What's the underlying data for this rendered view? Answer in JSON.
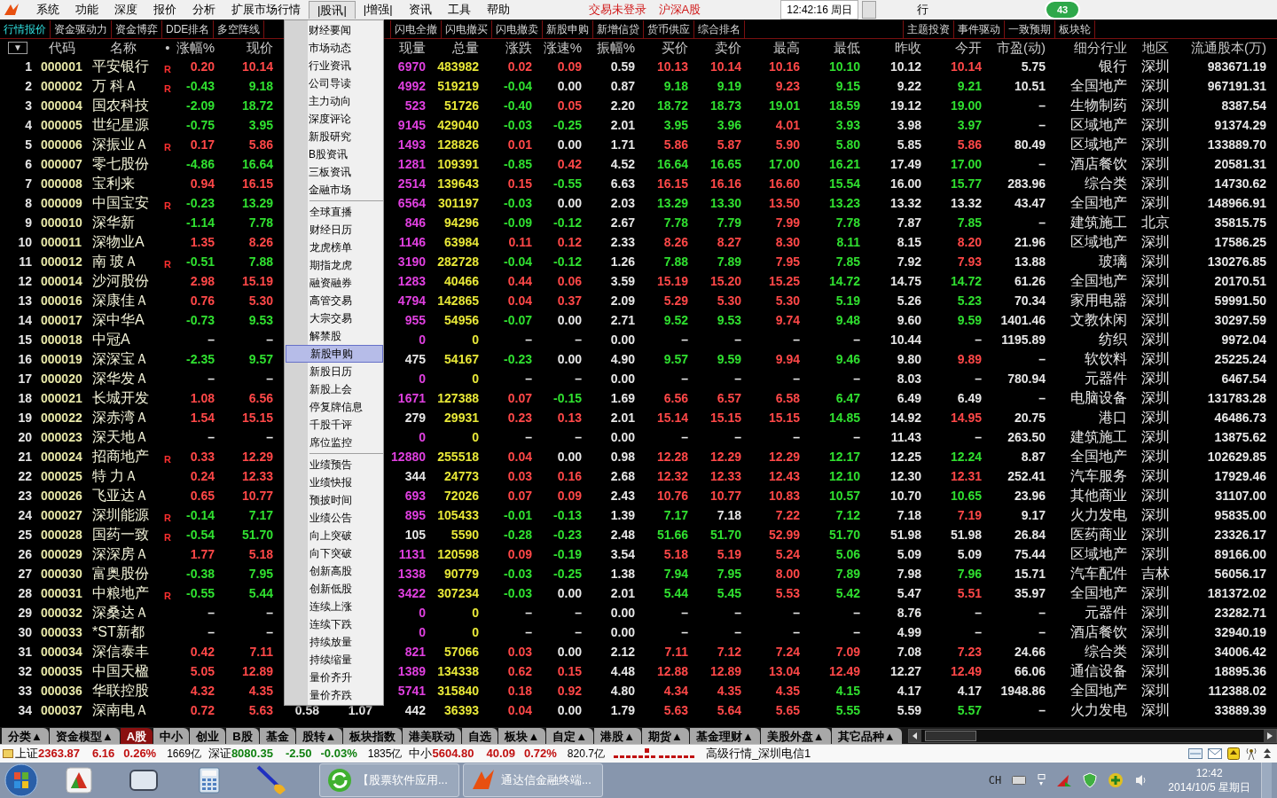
{
  "menubar": {
    "items": [
      {
        "label": "系统",
        "selected": false
      },
      {
        "label": "功能",
        "selected": false
      },
      {
        "label": "深度",
        "selected": false
      },
      {
        "label": "报价",
        "selected": false
      },
      {
        "label": "分析",
        "selected": false
      },
      {
        "label": "扩展市场行情",
        "selected": false
      },
      {
        "label": "|股讯|",
        "selected": true
      },
      {
        "label": "|增强|",
        "selected": false
      },
      {
        "label": "资讯",
        "selected": false
      },
      {
        "label": "工具",
        "selected": false
      },
      {
        "label": "帮助",
        "selected": false
      }
    ],
    "notices": [
      "交易未登录",
      "沪深A股"
    ],
    "clock": "12:42:16 周日",
    "badge": "43",
    "cut_label": "行"
  },
  "tabs": {
    "left": [
      {
        "label": "行情报价",
        "selected": true
      },
      {
        "label": "资金驱动力",
        "selected": false
      },
      {
        "label": "资金博弈",
        "selected": false
      },
      {
        "label": "DDE排名",
        "selected": false
      },
      {
        "label": "多空阵线",
        "selected": false
      }
    ],
    "middle": [
      {
        "label": "闪电全撤",
        "selected": false
      },
      {
        "label": "闪电撤买",
        "selected": false
      },
      {
        "label": "闪电撤卖",
        "selected": false
      },
      {
        "label": "新股申购",
        "selected": false
      },
      {
        "label": "新增信贷",
        "selected": false
      },
      {
        "label": "货币供应",
        "selected": false
      },
      {
        "label": "综合排名",
        "selected": false
      }
    ],
    "right": [
      {
        "label": "主题投资",
        "selected": false
      },
      {
        "label": "事件驱动",
        "selected": false
      },
      {
        "label": "一致预期",
        "selected": false
      },
      {
        "label": "板块轮",
        "selected": false
      }
    ]
  },
  "table": {
    "sort_button": "▼",
    "columns": [
      {
        "label": "代码",
        "kind": "code"
      },
      {
        "label": "名称",
        "kind": "name"
      },
      {
        "label": "•",
        "kind": "tag"
      },
      {
        "label": "涨幅%",
        "kind": "signed"
      },
      {
        "label": "现价",
        "kind": "price"
      },
      {
        "kind": "covered"
      },
      {
        "kind": "covered"
      },
      {
        "label": "现量",
        "kind": "tick_volume"
      },
      {
        "label": "总量",
        "kind": "volume"
      },
      {
        "label": "涨跌",
        "kind": "signed"
      },
      {
        "label": "涨速%",
        "kind": "signed"
      },
      {
        "label": "振幅%",
        "kind": "plain"
      },
      {
        "label": "买价",
        "kind": "price"
      },
      {
        "label": "卖价",
        "kind": "price"
      },
      {
        "label": "最高",
        "kind": "price"
      },
      {
        "label": "最低",
        "kind": "price"
      },
      {
        "label": "昨收",
        "kind": "base"
      },
      {
        "label": "今开",
        "kind": "price"
      },
      {
        "label": "市盈(动)",
        "kind": "plain"
      },
      {
        "label": "细分行业",
        "kind": "text"
      },
      {
        "label": "地区",
        "kind": "region"
      },
      {
        "label": "流通股本(万)",
        "kind": "plain"
      }
    ],
    "rows": [
      {
        "num": "1",
        "vol_hl": true,
        "cells": [
          "000001",
          "平安银行",
          "R",
          "0.20",
          "10.14",
          null,
          null,
          "6970",
          "483982",
          "0.02",
          "0.09",
          "0.59",
          "10.13",
          "10.14",
          "10.16",
          "10.10",
          "10.12",
          "10.14",
          "5.75",
          "银行",
          "深圳",
          "983671.19"
        ]
      },
      {
        "num": "2",
        "vol_hl": true,
        "cells": [
          "000002",
          "万 科Ａ",
          "R",
          "-0.43",
          "9.18",
          null,
          null,
          "4992",
          "519219",
          "-0.04",
          "0.00",
          "0.87",
          "9.18",
          "9.19",
          "9.23",
          "9.15",
          "9.22",
          "9.21",
          "10.51",
          "全国地产",
          "深圳",
          "967191.31"
        ]
      },
      {
        "num": "3",
        "vol_hl": true,
        "cells": [
          "000004",
          "国农科技",
          null,
          "-2.09",
          "18.72",
          null,
          null,
          "523",
          "51726",
          "-0.40",
          "0.05",
          "2.20",
          "18.72",
          "18.73",
          "19.01",
          "18.59",
          "19.12",
          "19.00",
          "–",
          "生物制药",
          "深圳",
          "8387.54"
        ]
      },
      {
        "num": "4",
        "vol_hl": true,
        "cells": [
          "000005",
          "世纪星源",
          null,
          "-0.75",
          "3.95",
          null,
          null,
          "9145",
          "429040",
          "-0.03",
          "-0.25",
          "2.01",
          "3.95",
          "3.96",
          "4.01",
          "3.93",
          "3.98",
          "3.97",
          "–",
          "区域地产",
          "深圳",
          "91374.29"
        ]
      },
      {
        "num": "5",
        "vol_hl": true,
        "cells": [
          "000006",
          "深振业Ａ",
          "R",
          "0.17",
          "5.86",
          null,
          null,
          "1493",
          "128826",
          "0.01",
          "0.00",
          "1.71",
          "5.86",
          "5.87",
          "5.90",
          "5.80",
          "5.85",
          "5.86",
          "80.49",
          "区域地产",
          "深圳",
          "133889.70"
        ]
      },
      {
        "num": "6",
        "vol_hl": true,
        "cells": [
          "000007",
          "零七股份",
          null,
          "-4.86",
          "16.64",
          null,
          null,
          "1281",
          "109391",
          "-0.85",
          "0.42",
          "4.52",
          "16.64",
          "16.65",
          "17.00",
          "16.21",
          "17.49",
          "17.00",
          "–",
          "酒店餐饮",
          "深圳",
          "20581.31"
        ]
      },
      {
        "num": "7",
        "vol_hl": true,
        "cells": [
          "000008",
          "宝利来",
          null,
          "0.94",
          "16.15",
          null,
          null,
          "2514",
          "139643",
          "0.15",
          "-0.55",
          "6.63",
          "16.15",
          "16.16",
          "16.60",
          "15.54",
          "16.00",
          "15.77",
          "283.96",
          "综合类",
          "深圳",
          "14730.62"
        ]
      },
      {
        "num": "8",
        "vol_hl": true,
        "cells": [
          "000009",
          "中国宝安",
          "R",
          "-0.23",
          "13.29",
          null,
          null,
          "6564",
          "301197",
          "-0.03",
          "0.00",
          "2.03",
          "13.29",
          "13.30",
          "13.50",
          "13.23",
          "13.32",
          "13.32",
          "43.47",
          "全国地产",
          "深圳",
          "148966.91"
        ]
      },
      {
        "num": "9",
        "vol_hl": true,
        "cells": [
          "000010",
          "深华新",
          null,
          "-1.14",
          "7.78",
          null,
          null,
          "846",
          "94296",
          "-0.09",
          "-0.12",
          "2.67",
          "7.78",
          "7.79",
          "7.99",
          "7.78",
          "7.87",
          "7.85",
          "–",
          "建筑施工",
          "北京",
          "35815.75"
        ]
      },
      {
        "num": "10",
        "vol_hl": true,
        "cells": [
          "000011",
          "深物业A",
          null,
          "1.35",
          "8.26",
          null,
          null,
          "1146",
          "63984",
          "0.11",
          "0.12",
          "2.33",
          "8.26",
          "8.27",
          "8.30",
          "8.11",
          "8.15",
          "8.20",
          "21.96",
          "区域地产",
          "深圳",
          "17586.25"
        ]
      },
      {
        "num": "11",
        "vol_hl": true,
        "cells": [
          "000012",
          "南 玻Ａ",
          "R",
          "-0.51",
          "7.88",
          null,
          null,
          "3190",
          "282728",
          "-0.04",
          "-0.12",
          "1.26",
          "7.88",
          "7.89",
          "7.95",
          "7.85",
          "7.92",
          "7.93",
          "13.88",
          "玻璃",
          "深圳",
          "130276.85"
        ]
      },
      {
        "num": "12",
        "vol_hl": true,
        "cells": [
          "000014",
          "沙河股份",
          null,
          "2.98",
          "15.19",
          null,
          null,
          "1283",
          "40466",
          "0.44",
          "0.06",
          "3.59",
          "15.19",
          "15.20",
          "15.25",
          "14.72",
          "14.75",
          "14.72",
          "61.26",
          "全国地产",
          "深圳",
          "20170.51"
        ]
      },
      {
        "num": "13",
        "vol_hl": true,
        "cells": [
          "000016",
          "深康佳Ａ",
          null,
          "0.76",
          "5.30",
          null,
          null,
          "4794",
          "142865",
          "0.04",
          "0.37",
          "2.09",
          "5.29",
          "5.30",
          "5.30",
          "5.19",
          "5.26",
          "5.23",
          "70.34",
          "家用电器",
          "深圳",
          "59991.50"
        ]
      },
      {
        "num": "14",
        "vol_hl": true,
        "cells": [
          "000017",
          "深中华A",
          null,
          "-0.73",
          "9.53",
          null,
          null,
          "955",
          "54956",
          "-0.07",
          "0.00",
          "2.71",
          "9.52",
          "9.53",
          "9.74",
          "9.48",
          "9.60",
          "9.59",
          "1401.46",
          "文教休闲",
          "深圳",
          "30297.59"
        ]
      },
      {
        "num": "15",
        "vol_hl": true,
        "cells": [
          "000018",
          "中冠A",
          null,
          "–",
          "–",
          null,
          null,
          "0",
          "0",
          "–",
          "–",
          "0.00",
          "–",
          "–",
          "–",
          "–",
          "10.44",
          "–",
          "1195.89",
          "纺织",
          "深圳",
          "9972.04"
        ]
      },
      {
        "num": "16",
        "vol_hl": false,
        "cells": [
          "000019",
          "深深宝Ａ",
          null,
          "-2.35",
          "9.57",
          null,
          null,
          "475",
          "54167",
          "-0.23",
          "0.00",
          "4.90",
          "9.57",
          "9.59",
          "9.94",
          "9.46",
          "9.80",
          "9.89",
          "–",
          "软饮料",
          "深圳",
          "25225.24"
        ]
      },
      {
        "num": "17",
        "vol_hl": true,
        "cells": [
          "000020",
          "深华发Ａ",
          null,
          "–",
          "–",
          null,
          null,
          "0",
          "0",
          "–",
          "–",
          "0.00",
          "–",
          "–",
          "–",
          "–",
          "8.03",
          "–",
          "780.94",
          "元器件",
          "深圳",
          "6467.54"
        ]
      },
      {
        "num": "18",
        "vol_hl": true,
        "cells": [
          "000021",
          "长城开发",
          null,
          "1.08",
          "6.56",
          null,
          null,
          "1671",
          "127388",
          "0.07",
          "-0.15",
          "1.69",
          "6.56",
          "6.57",
          "6.58",
          "6.47",
          "6.49",
          "6.49",
          "–",
          "电脑设备",
          "深圳",
          "131783.28"
        ]
      },
      {
        "num": "19",
        "vol_hl": false,
        "cells": [
          "000022",
          "深赤湾Ａ",
          null,
          "1.54",
          "15.15",
          null,
          null,
          "279",
          "29931",
          "0.23",
          "0.13",
          "2.01",
          "15.14",
          "15.15",
          "15.15",
          "14.85",
          "14.92",
          "14.95",
          "20.75",
          "港口",
          "深圳",
          "46486.73"
        ]
      },
      {
        "num": "20",
        "vol_hl": true,
        "cells": [
          "000023",
          "深天地Ａ",
          null,
          "–",
          "–",
          null,
          null,
          "0",
          "0",
          "–",
          "–",
          "0.00",
          "–",
          "–",
          "–",
          "–",
          "11.43",
          "–",
          "263.50",
          "建筑施工",
          "深圳",
          "13875.62"
        ]
      },
      {
        "num": "21",
        "vol_hl": true,
        "cells": [
          "000024",
          "招商地产",
          "R",
          "0.33",
          "12.29",
          null,
          null,
          "12880",
          "255518",
          "0.04",
          "0.00",
          "0.98",
          "12.28",
          "12.29",
          "12.29",
          "12.17",
          "12.25",
          "12.24",
          "8.87",
          "全国地产",
          "深圳",
          "102629.85"
        ]
      },
      {
        "num": "22",
        "vol_hl": false,
        "cells": [
          "000025",
          "特 力Ａ",
          null,
          "0.24",
          "12.33",
          null,
          null,
          "344",
          "24773",
          "0.03",
          "0.16",
          "2.68",
          "12.32",
          "12.33",
          "12.43",
          "12.10",
          "12.30",
          "12.31",
          "252.41",
          "汽车服务",
          "深圳",
          "17929.46"
        ]
      },
      {
        "num": "23",
        "vol_hl": true,
        "cells": [
          "000026",
          "飞亚达Ａ",
          null,
          "0.65",
          "10.77",
          null,
          null,
          "693",
          "72026",
          "0.07",
          "0.09",
          "2.43",
          "10.76",
          "10.77",
          "10.83",
          "10.57",
          "10.70",
          "10.65",
          "23.96",
          "其他商业",
          "深圳",
          "31107.00"
        ]
      },
      {
        "num": "24",
        "vol_hl": true,
        "cells": [
          "000027",
          "深圳能源",
          "R",
          "-0.14",
          "7.17",
          null,
          null,
          "895",
          "105433",
          "-0.01",
          "-0.13",
          "1.39",
          "7.17",
          "7.18",
          "7.22",
          "7.12",
          "7.18",
          "7.19",
          "9.17",
          "火力发电",
          "深圳",
          "95835.00"
        ]
      },
      {
        "num": "25",
        "vol_hl": false,
        "cells": [
          "000028",
          "国药一致",
          "R",
          "-0.54",
          "51.70",
          null,
          null,
          "105",
          "5590",
          "-0.28",
          "-0.23",
          "2.48",
          "51.66",
          "51.70",
          "52.99",
          "51.70",
          "51.98",
          "51.98",
          "26.84",
          "医药商业",
          "深圳",
          "23326.17"
        ]
      },
      {
        "num": "26",
        "vol_hl": true,
        "cells": [
          "000029",
          "深深房Ａ",
          null,
          "1.77",
          "5.18",
          null,
          null,
          "1131",
          "120598",
          "0.09",
          "-0.19",
          "3.54",
          "5.18",
          "5.19",
          "5.24",
          "5.06",
          "5.09",
          "5.09",
          "75.44",
          "区域地产",
          "深圳",
          "89166.00"
        ]
      },
      {
        "num": "27",
        "vol_hl": true,
        "cells": [
          "000030",
          "富奥股份",
          null,
          "-0.38",
          "7.95",
          null,
          null,
          "1338",
          "90779",
          "-0.03",
          "-0.25",
          "1.38",
          "7.94",
          "7.95",
          "8.00",
          "7.89",
          "7.98",
          "7.96",
          "15.71",
          "汽车配件",
          "吉林",
          "56056.17"
        ]
      },
      {
        "num": "28",
        "vol_hl": true,
        "cells": [
          "000031",
          "中粮地产",
          "R",
          "-0.55",
          "5.44",
          null,
          null,
          "3422",
          "307234",
          "-0.03",
          "0.00",
          "2.01",
          "5.44",
          "5.45",
          "5.53",
          "5.42",
          "5.47",
          "5.51",
          "35.97",
          "全国地产",
          "深圳",
          "181372.02"
        ]
      },
      {
        "num": "29",
        "vol_hl": true,
        "cells": [
          "000032",
          "深桑达Ａ",
          null,
          "–",
          "–",
          null,
          null,
          "0",
          "0",
          "–",
          "–",
          "0.00",
          "–",
          "–",
          "–",
          "–",
          "8.76",
          "–",
          "–",
          "元器件",
          "深圳",
          "23282.71"
        ]
      },
      {
        "num": "30",
        "vol_hl": true,
        "cells": [
          "000033",
          "*ST新都",
          null,
          "–",
          "–",
          null,
          null,
          "0",
          "0",
          "–",
          "–",
          "0.00",
          "–",
          "–",
          "–",
          "–",
          "4.99",
          "–",
          "–",
          "酒店餐饮",
          "深圳",
          "32940.19"
        ]
      },
      {
        "num": "31",
        "vol_hl": true,
        "cells": [
          "000034",
          "深信泰丰",
          null,
          "0.42",
          "7.11",
          null,
          null,
          "821",
          "57066",
          "0.03",
          "0.00",
          "2.12",
          "7.11",
          "7.12",
          "7.24",
          "7.09",
          "7.08",
          "7.23",
          "24.66",
          "综合类",
          "深圳",
          "34006.42"
        ]
      },
      {
        "num": "32",
        "vol_hl": true,
        "cells": [
          "000035",
          "中国天楹",
          null,
          "5.05",
          "12.89",
          null,
          null,
          "1389",
          "134338",
          "0.62",
          "0.15",
          "4.48",
          "12.88",
          "12.89",
          "13.04",
          "12.49",
          "12.27",
          "12.49",
          "66.06",
          "通信设备",
          "深圳",
          "18895.36"
        ]
      },
      {
        "num": "33",
        "vol_hl": true,
        "cells": [
          "000036",
          "华联控股",
          null,
          "4.32",
          "4.35",
          null,
          null,
          "5741",
          "315840",
          "0.18",
          "0.92",
          "4.80",
          "4.34",
          "4.35",
          "4.35",
          "4.15",
          "4.17",
          "4.17",
          "1948.86",
          "全国地产",
          "深圳",
          "112388.02"
        ]
      },
      {
        "num": "34",
        "vol_hl": false,
        "cells": [
          "000037",
          "深南电Ａ",
          null,
          "0.72",
          "5.63",
          "0.58",
          "1.07",
          "442",
          "36393",
          "0.04",
          "0.00",
          "1.79",
          "5.63",
          "5.64",
          "5.65",
          "5.55",
          "5.59",
          "5.57",
          "–",
          "火力发电",
          "深圳",
          "33889.39"
        ]
      }
    ]
  },
  "dropdown": {
    "sections": [
      [
        {
          "label": "财经要闻",
          "selected": false
        },
        {
          "label": "市场动态",
          "selected": false
        },
        {
          "label": "行业资讯",
          "selected": false
        },
        {
          "label": "公司导读",
          "selected": false
        },
        {
          "label": "主力动向",
          "selected": false
        },
        {
          "label": "深度评论",
          "selected": false
        },
        {
          "label": "新股研究",
          "selected": false
        },
        {
          "label": "B股资讯",
          "selected": false
        },
        {
          "label": "三板资讯",
          "selected": false
        },
        {
          "label": "金融市场",
          "selected": false
        }
      ],
      [
        {
          "label": "全球直播",
          "selected": false
        },
        {
          "label": "财经日历",
          "selected": false
        },
        {
          "label": "龙虎榜单",
          "selected": false
        },
        {
          "label": "期指龙虎",
          "selected": false
        },
        {
          "label": "融资融券",
          "selected": false
        },
        {
          "label": "高管交易",
          "selected": false
        },
        {
          "label": "大宗交易",
          "selected": false
        },
        {
          "label": "解禁股",
          "selected": false
        },
        {
          "label": "新股申购",
          "selected": true
        },
        {
          "label": "新股日历",
          "selected": false
        },
        {
          "label": "新股上会",
          "selected": false
        },
        {
          "label": "停复牌信息",
          "selected": false
        },
        {
          "label": "千股千评",
          "selected": false
        },
        {
          "label": "席位监控",
          "selected": false
        }
      ],
      [
        {
          "label": "业绩预告",
          "selected": false
        },
        {
          "label": "业绩快报",
          "selected": false
        },
        {
          "label": "预披时间",
          "selected": false
        },
        {
          "label": "业绩公告",
          "selected": false
        },
        {
          "label": "向上突破",
          "selected": false
        },
        {
          "label": "向下突破",
          "selected": false
        },
        {
          "label": "创新高股",
          "selected": false
        },
        {
          "label": "创新低股",
          "selected": false
        },
        {
          "label": "连续上涨",
          "selected": false
        },
        {
          "label": "连续下跌",
          "selected": false
        },
        {
          "label": "持续放量",
          "selected": false
        },
        {
          "label": "持续缩量",
          "selected": false
        },
        {
          "label": "量价齐升",
          "selected": false
        },
        {
          "label": "量价齐跌",
          "selected": false
        }
      ]
    ]
  },
  "bottom_tabs": [
    {
      "label": "分类▲",
      "selected": false
    },
    {
      "label": "资金模型▲",
      "selected": false
    },
    {
      "label": "A股",
      "selected": true
    },
    {
      "label": "中小",
      "selected": false
    },
    {
      "label": "创业",
      "selected": false
    },
    {
      "label": "B股",
      "selected": false
    },
    {
      "label": "基金",
      "selected": false
    },
    {
      "label": "股转▲",
      "selected": false
    },
    {
      "label": "板块指数",
      "selected": false
    },
    {
      "label": "港美联动",
      "selected": false
    },
    {
      "label": "自选",
      "selected": false
    },
    {
      "label": "板块▲",
      "selected": false
    },
    {
      "label": "自定▲",
      "selected": false
    },
    {
      "label": "港股▲",
      "selected": false
    },
    {
      "label": "期货▲",
      "selected": false
    },
    {
      "label": "基金理财▲",
      "selected": false
    },
    {
      "label": "美股外盘▲",
      "selected": false
    },
    {
      "label": "其它品种▲",
      "selected": false
    }
  ],
  "status": {
    "indices": [
      {
        "name": "上证",
        "value": "2363.87",
        "change": "6.16",
        "pct": "0.26%",
        "amount": "1669亿",
        "rising": true
      },
      {
        "name": "深证",
        "value": "8080.35",
        "change": "-2.50",
        "pct": "-0.03%",
        "amount": "1835亿",
        "rising": false
      },
      {
        "name": "中小",
        "value": "5604.80",
        "change": "40.09",
        "pct": "0.72%",
        "amount": "820.7亿",
        "rising": true
      }
    ],
    "server": "高级行情_深圳电信1"
  },
  "taskbar": {
    "tasks": [
      {
        "label": "【股票软件应用..."
      },
      {
        "label": "通达信金融终端..."
      }
    ],
    "lang": "CH",
    "time": "12:42",
    "date": "2014/10/5 星期日"
  }
}
